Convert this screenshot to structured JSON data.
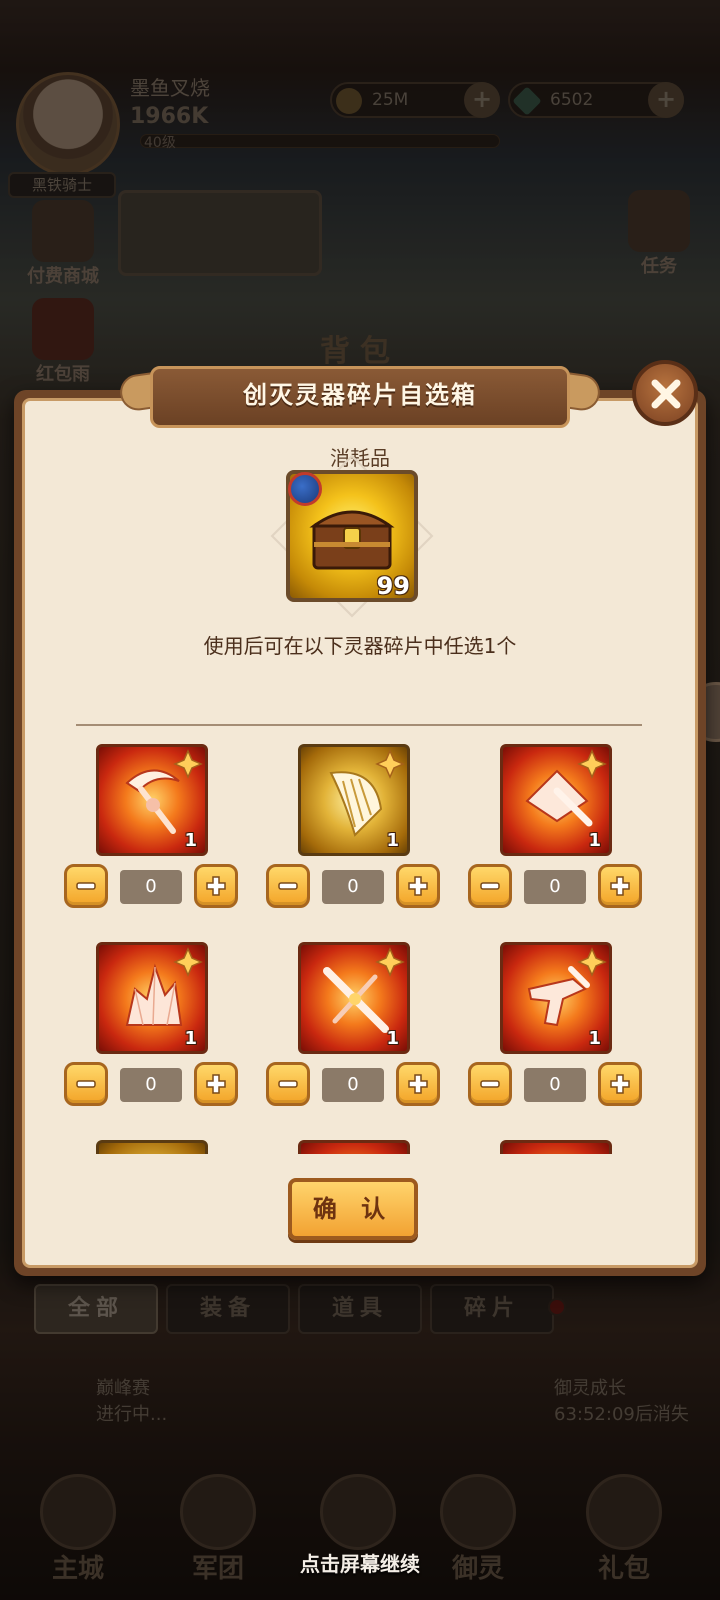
{
  "header": {
    "player_name": "墨鱼叉烧",
    "power": "1966K",
    "level": "40级",
    "gold": "25M",
    "diamonds": "6502",
    "title_badge": "黑铁骑士"
  },
  "side_icons": {
    "paid_shop": "付费商城",
    "red_packet": "红包雨",
    "tasks": "任务"
  },
  "background_panel_title": "背包",
  "dialog": {
    "title": "创灭灵器碎片自选箱",
    "item_type": "消耗品",
    "item_count": "99",
    "description": "使用后可在以下灵器碎片中任选1个",
    "confirm_label": "确 认",
    "options": [
      {
        "qty": "1",
        "value": "0",
        "style": "red",
        "icon": "scythe-fragment-icon"
      },
      {
        "qty": "1",
        "value": "0",
        "style": "gold",
        "icon": "harp-fragment-icon"
      },
      {
        "qty": "1",
        "value": "0",
        "style": "red",
        "icon": "crossbow-fragment-icon"
      },
      {
        "qty": "1",
        "value": "0",
        "style": "red",
        "icon": "crystal-fragment-icon"
      },
      {
        "qty": "1",
        "value": "0",
        "style": "red",
        "icon": "sword-fragment-icon"
      },
      {
        "qty": "1",
        "value": "0",
        "style": "red",
        "icon": "pistol-fragment-icon"
      }
    ]
  },
  "tabs": [
    "全部",
    "装备",
    "道具",
    "碎片"
  ],
  "events": {
    "peak_name": "巅峰赛",
    "peak_status": "进行中...",
    "growth_name": "御灵成长",
    "growth_timer": "63:52:09后消失"
  },
  "bottom_nav": [
    "主城",
    "军团",
    "",
    "御灵",
    "礼包"
  ],
  "continue_hint": "点击屏幕继续",
  "colors": {
    "dialog_bg": "#f3e8d6",
    "dialog_border": "#6e4427",
    "button_gold": "#f3a428",
    "title_plate": "#6b4124"
  }
}
